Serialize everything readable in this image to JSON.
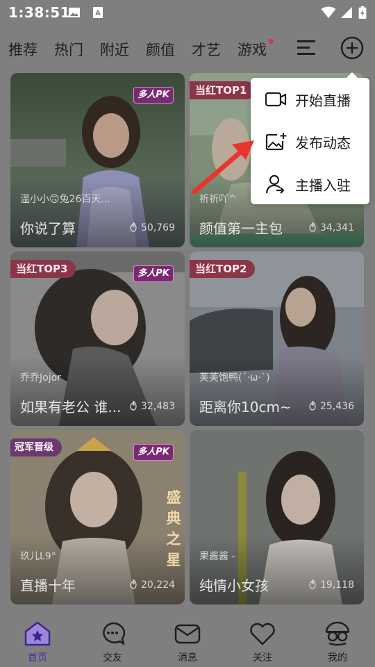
{
  "status_bar": {
    "time": "1:38:51"
  },
  "tabs": [
    {
      "label": "推荐"
    },
    {
      "label": "热门"
    },
    {
      "label": "附近"
    },
    {
      "label": "颜值"
    },
    {
      "label": "才艺"
    },
    {
      "label": "游戏",
      "has_dot": true
    }
  ],
  "cards": [
    {
      "rank_badge": "",
      "pk_badge": "多人PK",
      "user": "温小小🙃兔26百天...",
      "title": "你说了算",
      "count": "50,769"
    },
    {
      "rank_badge": "当红TOP1",
      "pk_badge": "",
      "user": "祈祈吖^",
      "title": "颜值第一主包",
      "count": "34,341"
    },
    {
      "rank_badge": "当红TOP3",
      "pk_badge": "多人PK",
      "user": "乔乔Jojor",
      "title": "如果有老公 谁...",
      "count": "32,483"
    },
    {
      "rank_badge": "当红TOP2",
      "pk_badge": "",
      "user": "芙芙饱鸭(ˊ·ω·ˋ)",
      "title": "距离你10cm~",
      "count": "25,436"
    },
    {
      "rank_badge": "冠军晋级",
      "pk_badge": "多人PK",
      "user": "玖儿L9°",
      "title": "直播十年",
      "count": "20,224",
      "side_text": "盛典之星"
    },
    {
      "rank_badge": "",
      "pk_badge": "",
      "user": "果酱酱 -",
      "title": "纯情小女孩",
      "count": "19,118"
    }
  ],
  "popup_menu": {
    "items": [
      {
        "label": "开始直播",
        "icon": "video-camera-icon"
      },
      {
        "label": "发布动态",
        "icon": "image-plus-icon"
      },
      {
        "label": "主播入驻",
        "icon": "user-add-icon"
      }
    ]
  },
  "bottom_nav": {
    "items": [
      {
        "label": "首页",
        "icon": "home-icon",
        "active": true
      },
      {
        "label": "交友",
        "icon": "chat-bubble-icon"
      },
      {
        "label": "消息",
        "icon": "mail-icon"
      },
      {
        "label": "关注",
        "icon": "heart-icon"
      },
      {
        "label": "我的",
        "icon": "glasses-face-icon"
      }
    ]
  },
  "colors": {
    "accent": "#4b2aa6",
    "tab_dot": "#d0384f",
    "arrow": "#e8362f"
  }
}
